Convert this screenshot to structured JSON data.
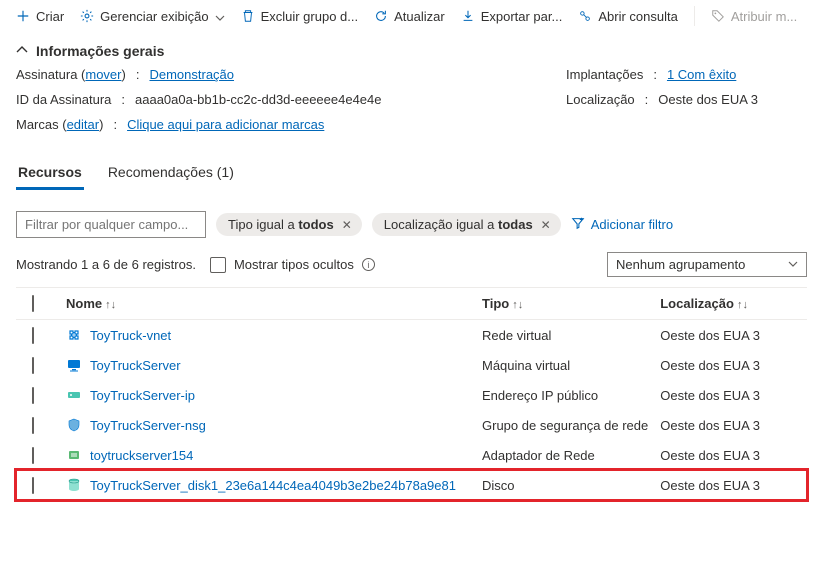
{
  "toolbar": {
    "create": "Criar",
    "manage_view": "Gerenciar exibição",
    "delete_group": "Excluir grupo d...",
    "refresh": "Atualizar",
    "export": "Exportar par...",
    "open_query": "Abrir consulta",
    "assign": "Atribuir m..."
  },
  "section": {
    "title": "Informações gerais"
  },
  "info": {
    "subscription_lbl": "Assinatura (",
    "move": "mover",
    "subscription_val": "Demonstração",
    "sub_id_lbl": "ID da Assinatura",
    "sub_id_val": "aaaa0a0a-bb1b-cc2c-dd3d-eeeeee4e4e4e",
    "tags_lbl": "Marcas (",
    "edit": "editar",
    "tags_val": "Clique aqui para adicionar marcas",
    "deploy_lbl": "Implantações",
    "deploy_val": "1 Com êxito",
    "loc_lbl": "Localização",
    "loc_val": "Oeste dos EUA 3"
  },
  "tabs": {
    "resources": "Recursos",
    "recommendations": "Recomendações (1)"
  },
  "filters": {
    "placeholder": "Filtrar por qualquer campo...",
    "type_prefix": "Tipo igual a ",
    "type_val": "todos",
    "loc_prefix": "Localização igual a ",
    "loc_val": "todas",
    "add": "Adicionar filtro"
  },
  "show": {
    "count": "Mostrando 1 a 6 de 6 registros.",
    "hidden": "Mostrar tipos ocultos",
    "grouping": "Nenhum agrupamento"
  },
  "columns": {
    "name": "Nome",
    "type": "Tipo",
    "loc": "Localização"
  },
  "rows": [
    {
      "name": "ToyTruck-vnet",
      "type": "Rede virtual",
      "loc": "Oeste dos EUA 3"
    },
    {
      "name": "ToyTruckServer",
      "type": "Máquina virtual",
      "loc": "Oeste dos EUA 3"
    },
    {
      "name": "ToyTruckServer-ip",
      "type": "Endereço IP público",
      "loc": "Oeste dos EUA 3"
    },
    {
      "name": "ToyTruckServer-nsg",
      "type": "Grupo de segurança de rede",
      "loc": "Oeste dos EUA 3"
    },
    {
      "name": "toytruckserver154",
      "type": "Adaptador de Rede",
      "loc": "Oeste dos EUA 3"
    },
    {
      "name": "ToyTruckServer_disk1_23e6a144c4ea4049b3e2be24b78a9e81",
      "type": "Disco",
      "loc": "Oeste dos EUA 3"
    }
  ]
}
